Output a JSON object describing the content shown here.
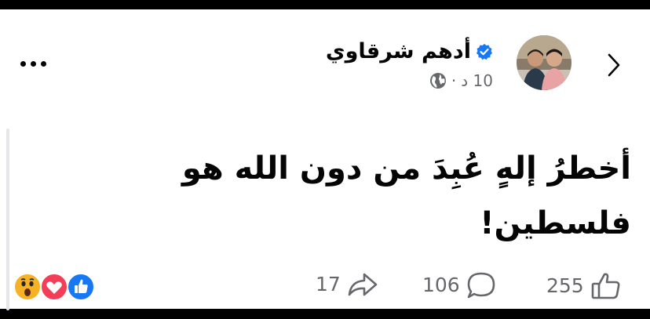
{
  "post": {
    "author": "أدهم  شرقاوي",
    "time": "10 د",
    "separator": "·",
    "text_line1": "أخطرُ إلهٍ عُبِدَ من دون الله هو",
    "text_line2": "فلسطين!"
  },
  "footer": {
    "likes": "255",
    "comments": "106",
    "shares": "17"
  },
  "colors": {
    "verified": "#1877f2",
    "like_reaction": "#1877f2",
    "love_reaction": "#f33e58",
    "wow_reaction": "#f7b125",
    "text": "#050505",
    "muted": "#65676b"
  },
  "icons": {
    "back": "chevron-right-icon",
    "more": "more-dots-icon",
    "verified": "verified-badge-icon",
    "audience": "globe-icon",
    "like": "thumbs-up-icon",
    "comment": "comment-bubble-icon",
    "share": "share-arrow-icon"
  }
}
